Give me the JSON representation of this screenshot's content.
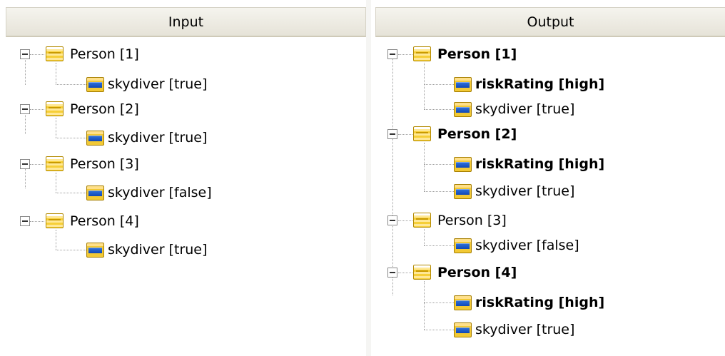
{
  "panels": {
    "input": {
      "title": "Input",
      "nodes": [
        {
          "label": "Person [1]",
          "child": "skydiver [true]"
        },
        {
          "label": "Person [2]",
          "child": "skydiver [true]"
        },
        {
          "label": "Person [3]",
          "child": "skydiver [false]"
        },
        {
          "label": "Person [4]",
          "child": "skydiver [true]"
        }
      ]
    },
    "output": {
      "title": "Output",
      "nodes": [
        {
          "label": "Person [1]",
          "children": [
            "riskRating [high]",
            "skydiver [true]"
          ]
        },
        {
          "label": "Person [2]",
          "children": [
            "riskRating [high]",
            "skydiver [true]"
          ]
        },
        {
          "label": "Person [3]",
          "children": [
            "skydiver [false]"
          ]
        },
        {
          "label": "Person [4]",
          "children": [
            "riskRating [high]",
            "skydiver [true]"
          ]
        }
      ]
    }
  },
  "icons": {
    "expander": "minus-box-icon",
    "object": "object-folder-icon",
    "attribute": "attribute-icon"
  },
  "colors": {
    "header_bg": "#e6e3d8",
    "icon_yellow": "#f6cf38",
    "icon_blue": "#1f5bc8",
    "tree_line": "#a0a0a0"
  }
}
